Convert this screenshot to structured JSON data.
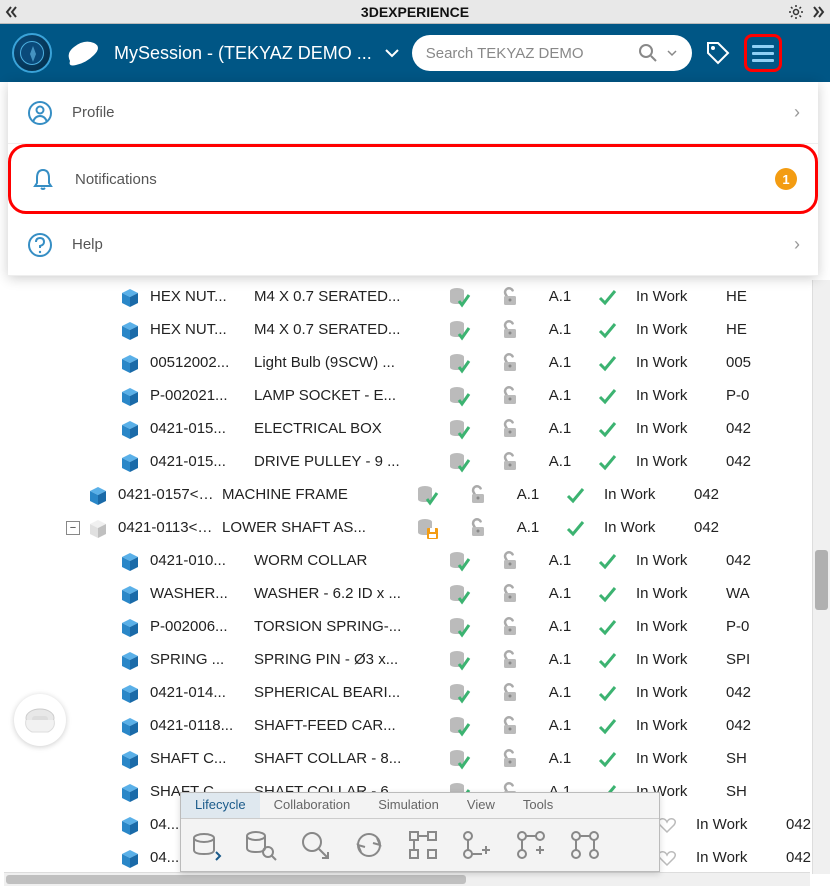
{
  "titlebar": {
    "title": "3DEXPERIENCE"
  },
  "header": {
    "session": "MySession - (TEKYAZ DEMO ...",
    "search_placeholder": "Search TEKYAZ DEMO"
  },
  "dropdown": {
    "profile": "Profile",
    "notifications": "Notifications",
    "notif_count": "1",
    "help": "Help"
  },
  "columns": {
    "rev": "A.1",
    "state": "In Work"
  },
  "rows": [
    {
      "depth": 2,
      "name": "HEX NUT...",
      "desc": "M4 X 0.7 SERATED...",
      "ext": "HE",
      "save": false
    },
    {
      "depth": 2,
      "name": "HEX NUT...",
      "desc": "M4 X 0.7 SERATED...",
      "ext": "HE",
      "save": false
    },
    {
      "depth": 2,
      "name": "00512002...",
      "desc": "Light Bulb (9SCW) ...",
      "ext": "005",
      "save": false
    },
    {
      "depth": 2,
      "name": "P-002021...",
      "desc": "LAMP SOCKET - E...",
      "ext": "P-0",
      "save": false
    },
    {
      "depth": 2,
      "name": "0421-015...",
      "desc": "ELECTRICAL BOX",
      "ext": "042",
      "save": false
    },
    {
      "depth": 2,
      "name": "0421-015...",
      "desc": "DRIVE PULLEY - 9 ...",
      "ext": "042",
      "save": false
    },
    {
      "depth": 1,
      "name": "0421-0157<1>",
      "desc": "MACHINE FRAME",
      "ext": "042",
      "save": false
    },
    {
      "depth": 1,
      "name": "0421-0113<1>",
      "desc": "LOWER SHAFT AS...",
      "ext": "042",
      "save": true,
      "asm": true,
      "exp": "-"
    },
    {
      "depth": 2,
      "name": "0421-010...",
      "desc": "WORM COLLAR",
      "ext": "042",
      "save": false
    },
    {
      "depth": 2,
      "name": "WASHER...",
      "desc": "WASHER - 6.2 ID x ...",
      "ext": "WA",
      "save": false
    },
    {
      "depth": 2,
      "name": "P-002006...",
      "desc": "TORSION SPRING-...",
      "ext": "P-0",
      "save": false
    },
    {
      "depth": 2,
      "name": "SPRING ...",
      "desc": "SPRING PIN - Ø3 x...",
      "ext": "SPI",
      "save": false
    },
    {
      "depth": 2,
      "name": "0421-014...",
      "desc": "SPHERICAL BEARI...",
      "ext": "042",
      "save": false
    },
    {
      "depth": 2,
      "name": "0421-0118...",
      "desc": "SHAFT-FEED CAR...",
      "ext": "042",
      "save": false
    },
    {
      "depth": 2,
      "name": "SHAFT C...",
      "desc": "SHAFT COLLAR - 8...",
      "ext": "SH",
      "save": false
    },
    {
      "depth": 2,
      "name": "SHAFT C...",
      "desc": "SHAFT COLLAR - 6...",
      "ext": "SH",
      "save": false
    },
    {
      "depth": 2,
      "name": "04...",
      "desc": "",
      "ext": "042",
      "save": false,
      "partial": true
    },
    {
      "depth": 2,
      "name": "04...",
      "desc": "",
      "ext": "042",
      "save": false,
      "partial": true
    }
  ],
  "toolbar": {
    "tabs": [
      "Lifecycle",
      "Collaboration",
      "Simulation",
      "View",
      "Tools"
    ],
    "active": 0
  }
}
